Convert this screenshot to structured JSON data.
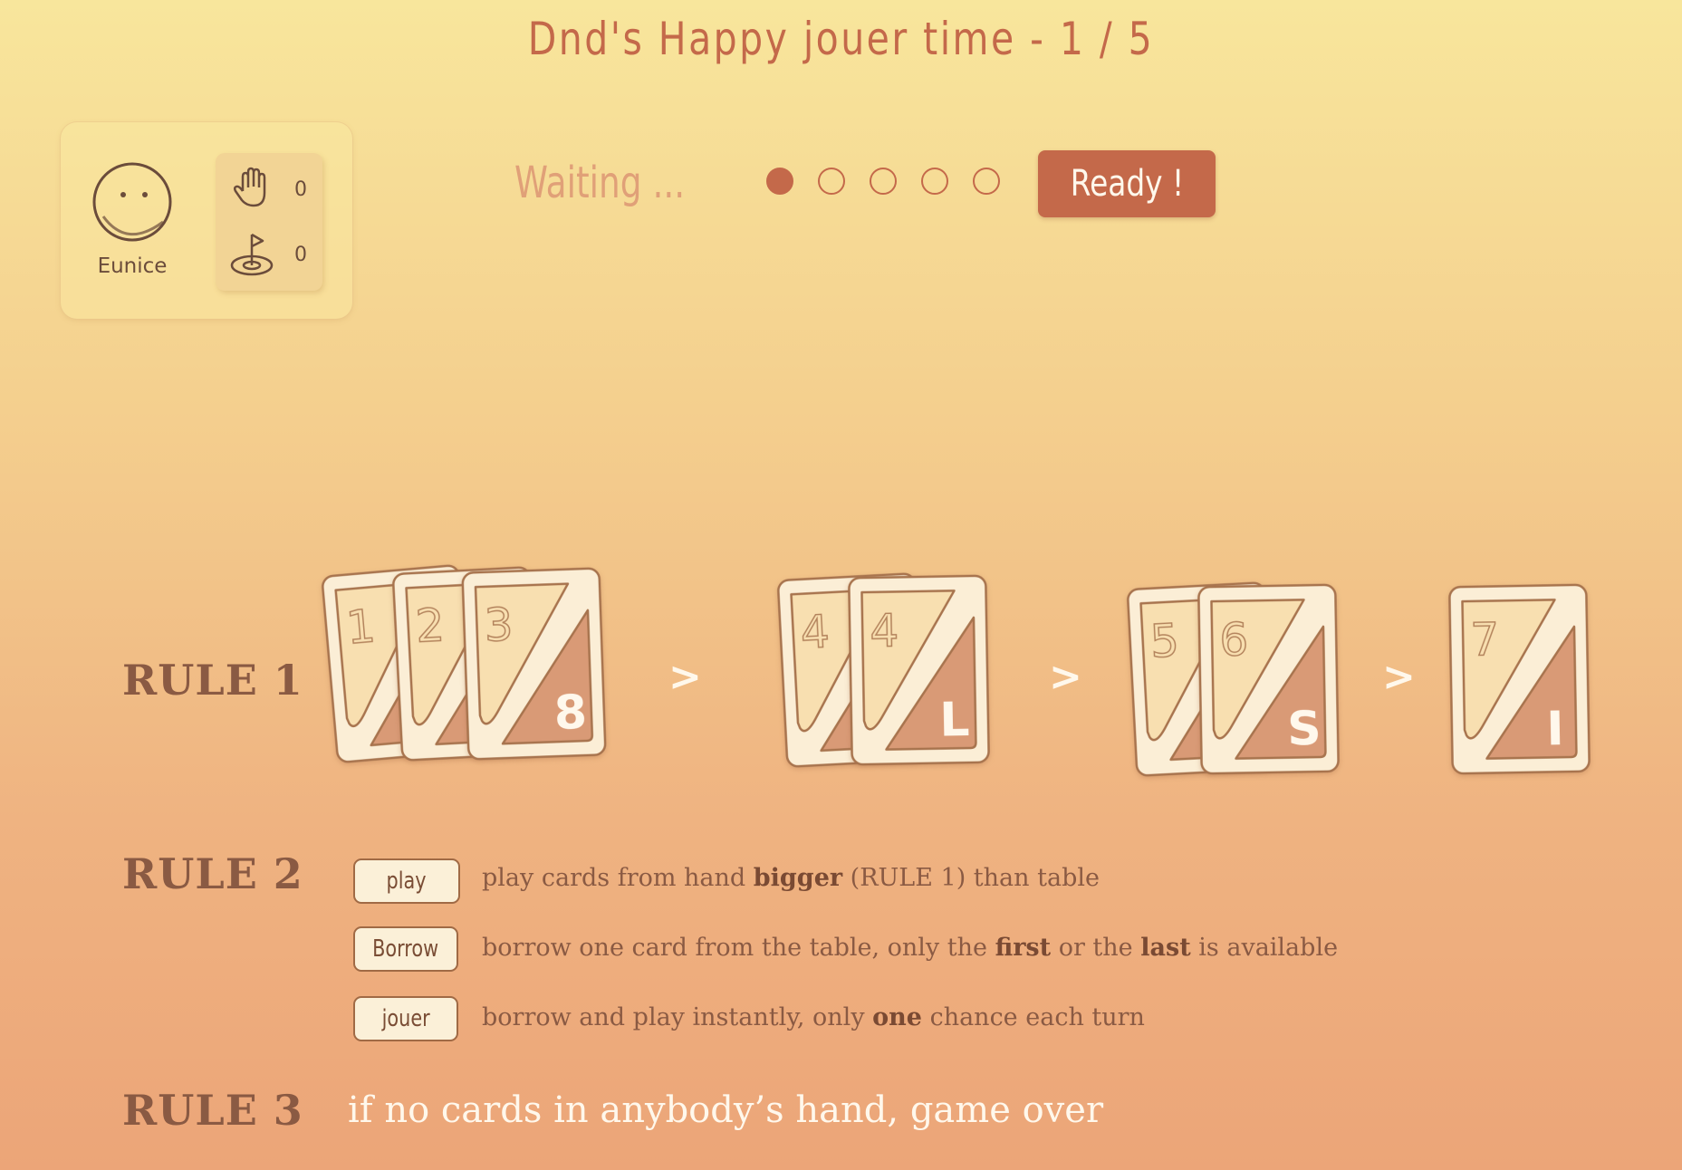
{
  "title": "Dnd's Happy jouer time - 1 / 5",
  "player": {
    "name": "Eunice",
    "avatar_icon": "face-icon",
    "hand_icon": "hand-icon",
    "hand_count": "0",
    "goal_icon": "flag-target-icon",
    "goal_count": "0"
  },
  "status": {
    "waiting_text": "Waiting ...",
    "rounds_total": 5,
    "rounds_done": 1,
    "ready_label": "Ready !"
  },
  "rules": {
    "rule1": {
      "label": "RULE 1",
      "separator": ">",
      "groups": [
        {
          "cards": [
            {
              "top": "1",
              "bottom": ""
            },
            {
              "top": "2",
              "bottom": ""
            },
            {
              "top": "3",
              "bottom": "8"
            }
          ]
        },
        {
          "cards": [
            {
              "top": "4",
              "bottom": ""
            },
            {
              "top": "4",
              "bottom": "L"
            }
          ]
        },
        {
          "cards": [
            {
              "top": "5",
              "bottom": ""
            },
            {
              "top": "6",
              "bottom": "S"
            }
          ]
        },
        {
          "cards": [
            {
              "top": "7",
              "bottom": "I"
            }
          ]
        }
      ]
    },
    "rule2": {
      "label": "RULE 2",
      "actions": [
        {
          "chip": "play",
          "pre": "play cards from hand ",
          "b1": "bigger",
          "mid": " (RULE 1) than table",
          "b2": "",
          "post": ""
        },
        {
          "chip": "Borrow",
          "pre": "borrow one card from the table, only the ",
          "b1": "first",
          "mid": " or the ",
          "b2": "last",
          "post": " is available"
        },
        {
          "chip": "jouer",
          "pre": "borrow and play instantly, only ",
          "b1": "one",
          "mid": " chance each turn",
          "b2": "",
          "post": ""
        }
      ]
    },
    "rule3": {
      "label": "RULE 3",
      "text": "if no cards in anybody’s hand, game over"
    }
  },
  "colors": {
    "accent": "#c4694a",
    "card_face": "#fbeed6",
    "card_top": "#f8dfb0",
    "card_bottom": "#d99a76",
    "card_border": "#a8744e"
  }
}
